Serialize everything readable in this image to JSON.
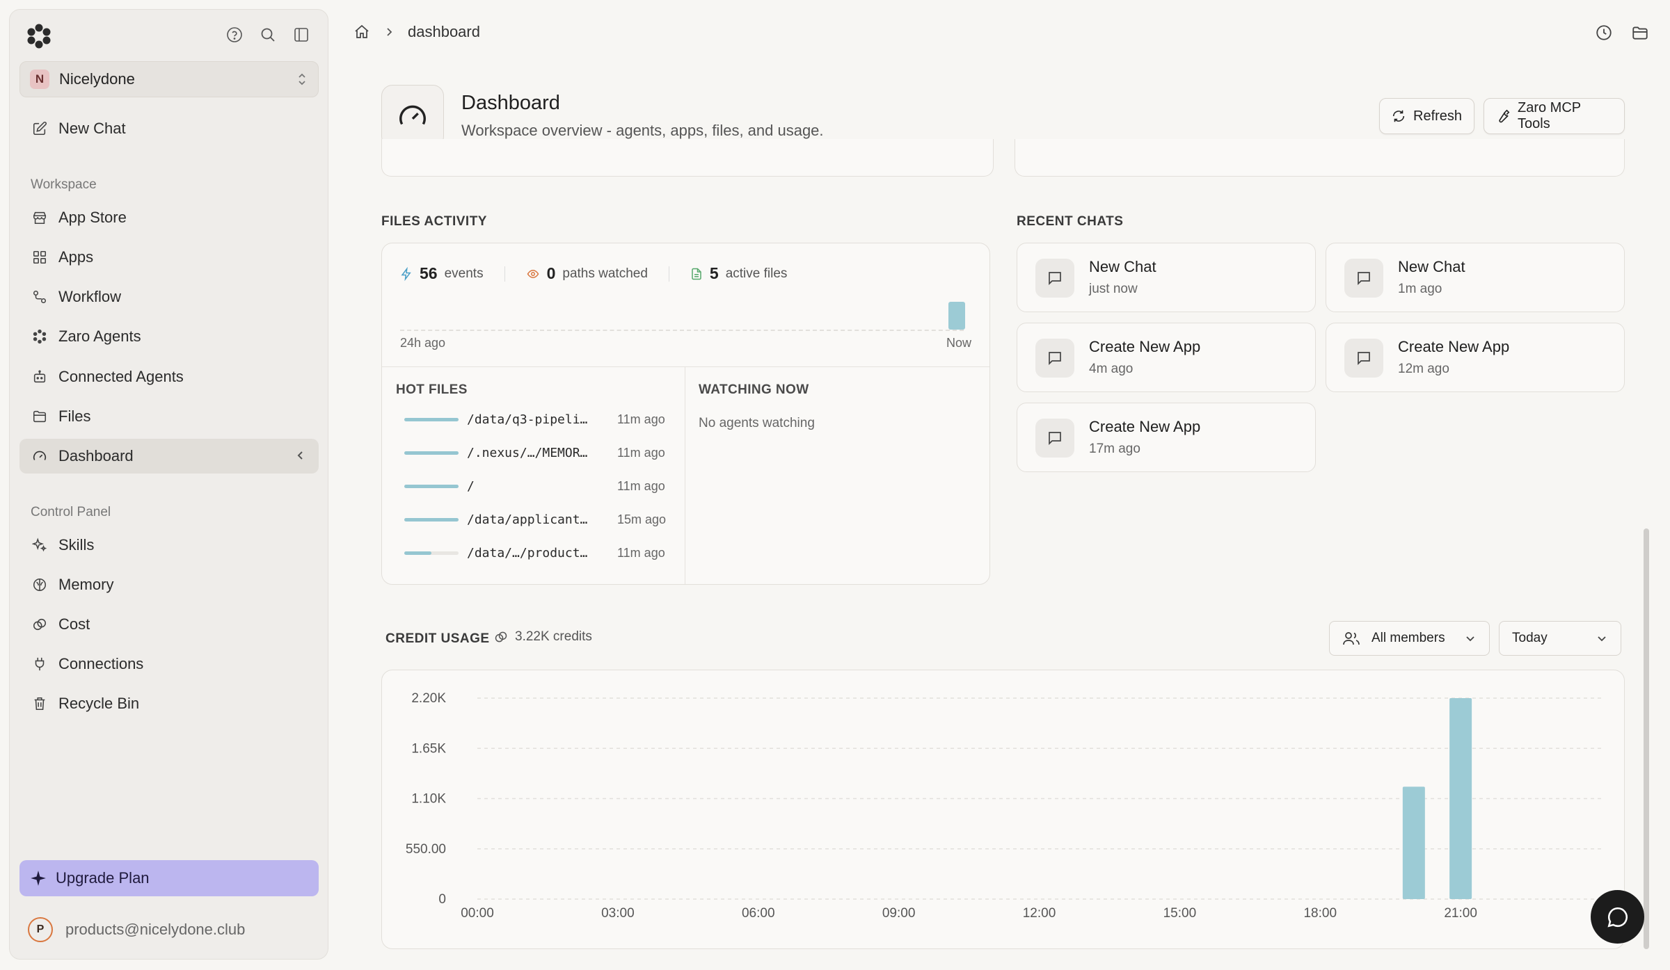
{
  "sidebar": {
    "workspace": {
      "initial": "N",
      "name": "Nicelydone"
    },
    "new_chat": "New Chat",
    "workspace_label": "Workspace",
    "workspace_items": [
      {
        "label": "App Store",
        "icon": "store-icon"
      },
      {
        "label": "Apps",
        "icon": "apps-grid-icon"
      },
      {
        "label": "Workflow",
        "icon": "workflow-icon"
      },
      {
        "label": "Zaro Agents",
        "icon": "agents-icon"
      },
      {
        "label": "Connected Agents",
        "icon": "robot-icon"
      },
      {
        "label": "Files",
        "icon": "folder-icon"
      },
      {
        "label": "Dashboard",
        "icon": "gauge-icon",
        "active": true
      }
    ],
    "control_label": "Control Panel",
    "control_items": [
      {
        "label": "Skills",
        "icon": "sparkles-icon"
      },
      {
        "label": "Memory",
        "icon": "brain-icon"
      },
      {
        "label": "Cost",
        "icon": "coins-icon"
      },
      {
        "label": "Connections",
        "icon": "plug-icon"
      },
      {
        "label": "Recycle Bin",
        "icon": "trash-icon"
      }
    ],
    "upgrade": "Upgrade Plan",
    "account": {
      "initial": "P",
      "email": "products@nicelydone.club"
    }
  },
  "breadcrumb": {
    "current": "dashboard"
  },
  "header": {
    "title": "Dashboard",
    "subtitle": "Workspace overview - agents, apps, files, and usage.",
    "refresh": "Refresh",
    "mcp": "Zaro MCP Tools"
  },
  "files_activity": {
    "title": "FILES ACTIVITY",
    "events": {
      "value": "56",
      "label": "events"
    },
    "paths": {
      "value": "0",
      "label": "paths watched"
    },
    "active": {
      "value": "5",
      "label": "active files"
    },
    "spark_start": "24h ago",
    "spark_end": "Now",
    "hot_title": "HOT FILES",
    "hot_files": [
      {
        "path": "/data/q3-pipeli…",
        "time": "11m ago",
        "level": 1.0
      },
      {
        "path": "/.nexus/…/MEMOR…",
        "time": "11m ago",
        "level": 1.0
      },
      {
        "path": "/",
        "time": "11m ago",
        "level": 1.0
      },
      {
        "path": "/data/applicant…",
        "time": "15m ago",
        "level": 1.0
      },
      {
        "path": "/data/…/product…",
        "time": "11m ago",
        "level": 0.5
      }
    ],
    "watching_title": "WATCHING NOW",
    "watching_empty": "No agents watching"
  },
  "recent_chats": {
    "title": "RECENT CHATS",
    "items": [
      {
        "title": "New Chat",
        "time": "just now"
      },
      {
        "title": "New Chat",
        "time": "1m ago"
      },
      {
        "title": "Create New App",
        "time": "4m ago"
      },
      {
        "title": "Create New App",
        "time": "12m ago"
      },
      {
        "title": "Create New App",
        "time": "17m ago"
      }
    ]
  },
  "credit_usage": {
    "title": "CREDIT USAGE",
    "total": "3.22K credits",
    "members_filter": "All members",
    "range_filter": "Today"
  },
  "chart_data": {
    "type": "bar",
    "title": "",
    "xlabel": "",
    "ylabel": "",
    "y_ticks": [
      "2.20K",
      "1.65K",
      "1.10K",
      "550.00",
      "0"
    ],
    "y_tick_values": [
      2200,
      1650,
      1100,
      550,
      0
    ],
    "ylim": [
      0,
      2200
    ],
    "x_ticks": [
      "00:00",
      "03:00",
      "06:00",
      "09:00",
      "12:00",
      "15:00",
      "18:00",
      "21:00"
    ],
    "x_range_hours": [
      0,
      24
    ],
    "bars": [
      {
        "hour": 20,
        "value": 1230
      },
      {
        "hour": 21,
        "value": 2200
      }
    ],
    "bar_color": "#9ccbd5",
    "grid": true
  },
  "colors": {
    "accent": "#bcb6ef",
    "bar": "#9ccbd5",
    "eye": "#d9773f",
    "bolt": "#4a9fc7",
    "file": "#56a86b"
  }
}
